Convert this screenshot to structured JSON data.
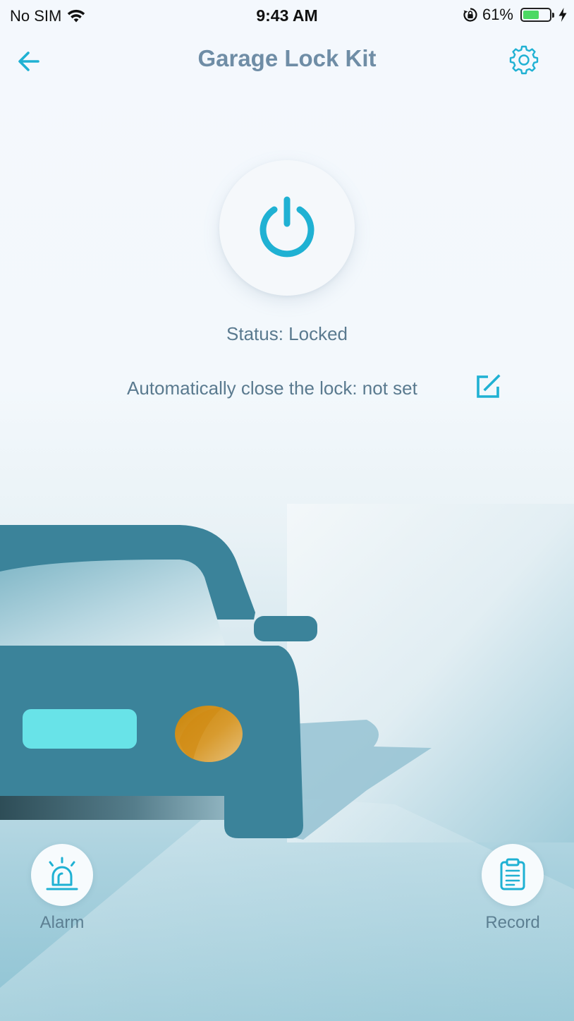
{
  "status_bar": {
    "carrier": "No SIM",
    "time": "9:43 AM",
    "battery_percent": "61%",
    "battery_level": 0.61
  },
  "nav": {
    "title": "Garage Lock Kit",
    "back_icon": "arrow-left-icon",
    "settings_icon": "gear-icon"
  },
  "lock": {
    "status": "Status: Locked",
    "auto_close": "Automatically close the lock: not set"
  },
  "actions": {
    "alarm_label": "Alarm",
    "record_label": "Record"
  },
  "colors": {
    "accent": "#1fb1d3",
    "car": "#3b839a",
    "headlight": "#68e3e8",
    "fog_light": "#d48b0b"
  }
}
